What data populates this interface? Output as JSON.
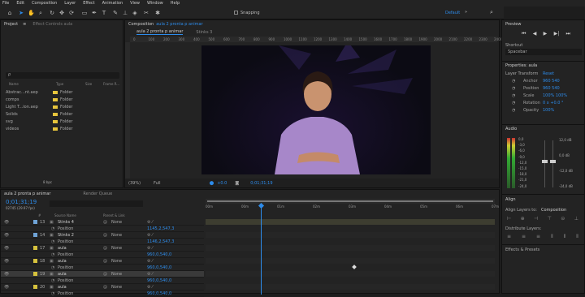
{
  "menu": [
    "File",
    "Edit",
    "Composition",
    "Layer",
    "Effect",
    "Animation",
    "View",
    "Window",
    "Help"
  ],
  "toolbar": {
    "snapping": "Snapping",
    "workspace": "Default",
    "workspace_menu": "»",
    "search_icon": "search-icon"
  },
  "project": {
    "tab": "Project",
    "effect_tab": "Effect Controls aula",
    "search_placeholder": "ρ",
    "columns": [
      "Name",
      "Type",
      "Size",
      "Frame R..."
    ],
    "items": [
      {
        "name": "Abstrac...nt.aep",
        "type": "Folder"
      },
      {
        "name": "comps",
        "type": "Folder"
      },
      {
        "name": "Light T...ion.aep",
        "type": "Folder"
      },
      {
        "name": "Solids",
        "type": "Folder"
      },
      {
        "name": "svg",
        "type": "Folder"
      },
      {
        "name": "videos",
        "type": "Folder"
      }
    ],
    "footer": "8 bpc"
  },
  "composition": {
    "tab_prefix": "Composition",
    "tab_name": "aula 2 pronta p animar",
    "sub_tab1": "aula 2 pronta p animar",
    "sub_tab2": "Stinks 3",
    "ruler": [
      "0",
      "100",
      "200",
      "300",
      "400",
      "500",
      "600",
      "700",
      "800",
      "900",
      "1000",
      "1100",
      "1200",
      "1300",
      "1400",
      "1500",
      "1600",
      "1700",
      "1800",
      "1900",
      "2000",
      "2100",
      "2200",
      "2300",
      "2400"
    ],
    "zoom": "(39%)",
    "resolution": "Full",
    "exposure": "+0.0",
    "timecode": "0;01;31;19"
  },
  "timeline": {
    "tab": "aula 2 pronta p animar",
    "render_tab": "Render Queue",
    "timecode": "0;01;31;19",
    "fps": "02745 (29.97 fps)",
    "columns": [
      "#",
      "Source Name",
      "Parent & Link"
    ],
    "layers": [
      {
        "num": "13",
        "name": "Stinks 4",
        "parent": "None",
        "prop": "Position",
        "prop_val": "1145,2,547,3"
      },
      {
        "num": "14",
        "name": "Stinks 2",
        "parent": "None",
        "prop": "Position",
        "prop_val": "1146,2,547,3"
      },
      {
        "num": "17",
        "name": "aula",
        "parent": "None",
        "prop": "Position",
        "prop_val": "960,0,540,0"
      },
      {
        "num": "18",
        "name": "aula",
        "parent": "None",
        "prop": "Position",
        "prop_val": "960,0,540,0"
      },
      {
        "num": "19",
        "name": "aula",
        "parent": "None",
        "prop": "Position",
        "prop_val": "960,0,540,0"
      },
      {
        "num": "20",
        "name": "aula",
        "parent": "None",
        "prop": "Position",
        "prop_val": "960,0,540,0"
      }
    ],
    "time_ticks": [
      "00m",
      "00m",
      "01m",
      "02m",
      "03m",
      "04m",
      "05m",
      "06m",
      "07m"
    ]
  },
  "preview": {
    "title": "Preview",
    "shortcut_label": "Shortcut",
    "shortcut_value": "Spacebar"
  },
  "properties": {
    "title": "Properties: aula",
    "section": "Layer Transform",
    "reset": "Reset",
    "rows": [
      {
        "label": "Anchor",
        "value": "960   540"
      },
      {
        "label": "Position",
        "value": "960   540"
      },
      {
        "label": "Scale",
        "value": "100%   100%"
      },
      {
        "label": "Rotation",
        "value": "0 x +0.0 °"
      },
      {
        "label": "Opacity",
        "value": "100%"
      }
    ]
  },
  "audio": {
    "title": "Audio",
    "db_left": [
      "0,0",
      "-3,0",
      "-6,0",
      "-9,0",
      "-12,0",
      "-15,0",
      "-18,0",
      "-21,0",
      "-24,0"
    ],
    "db_right": [
      "12,0 dB",
      "0,0 dB",
      "-12,0 dB",
      "-24,0 dB"
    ]
  },
  "align": {
    "title": "Align",
    "align_to_label": "Align Layers to:",
    "align_to_value": "Composition",
    "distribute": "Distribute Layers:",
    "effects": "Effects & Presets"
  }
}
